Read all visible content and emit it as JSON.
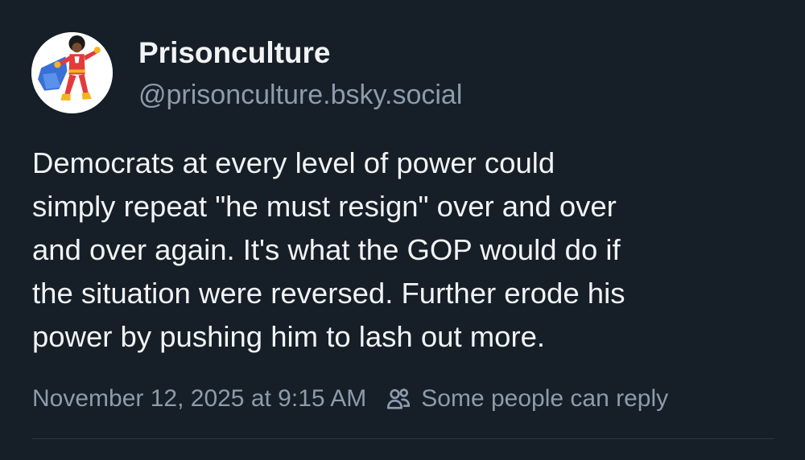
{
  "post": {
    "author": {
      "display_name": "Prisonculture",
      "handle": "@prisonculture.bsky.social",
      "avatar_icon": "superhero-avatar-icon"
    },
    "text": "Democrats at every level of power could\nsimply repeat \"he must resign\" over and over\nand over again. It's what the GOP would do if\nthe situation were reversed. Further erode his\npower by pushing him to lash out more.",
    "timestamp": "November 12, 2025 at 9:15 AM",
    "reply_setting": {
      "label": "Some people can reply",
      "icon": "people-icon"
    }
  },
  "colors": {
    "background": "#161e27",
    "text_primary": "#f1f3f5",
    "text_secondary": "#8c9cad",
    "divider": "#2a3643"
  }
}
